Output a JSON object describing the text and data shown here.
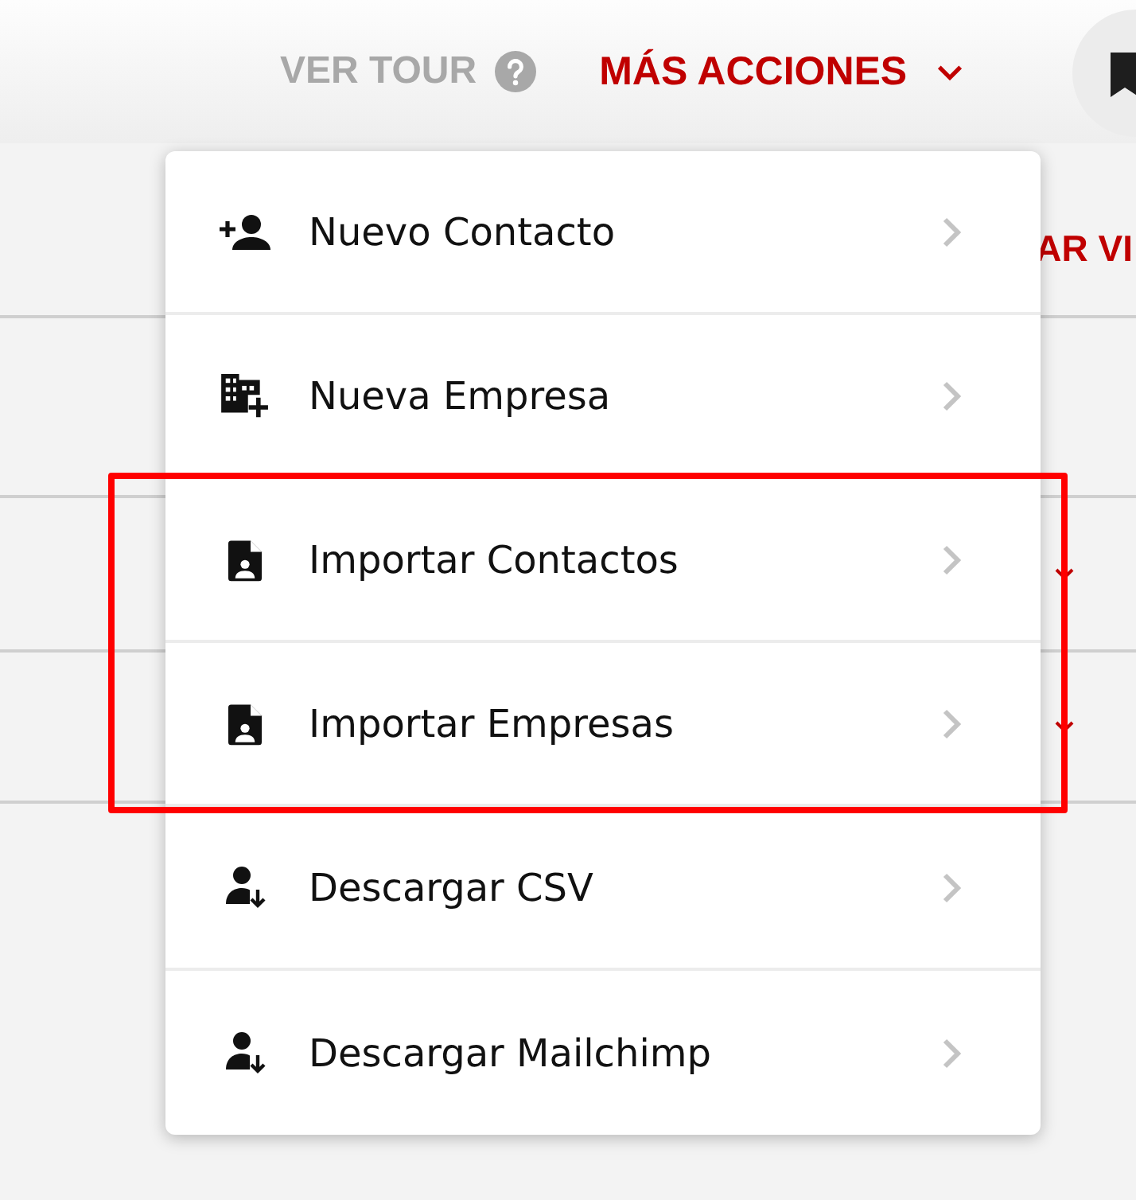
{
  "top_bar": {
    "tour_link": "VER TOUR",
    "more_actions": "MÁS ACCIONES"
  },
  "background": {
    "button_text": "AR VI"
  },
  "menu": {
    "items": [
      {
        "label": "Nuevo Contacto",
        "kind": "add",
        "highlighted": false
      },
      {
        "label": "Nueva Empresa",
        "kind": "company",
        "highlighted": false
      },
      {
        "label": "Importar Contactos",
        "kind": "import",
        "highlighted": true
      },
      {
        "label": "Importar Empresas",
        "kind": "import",
        "highlighted": true
      },
      {
        "label": "Descargar CSV",
        "kind": "download",
        "highlighted": false
      },
      {
        "label": "Descargar Mailchimp",
        "kind": "download",
        "highlighted": false
      }
    ]
  }
}
